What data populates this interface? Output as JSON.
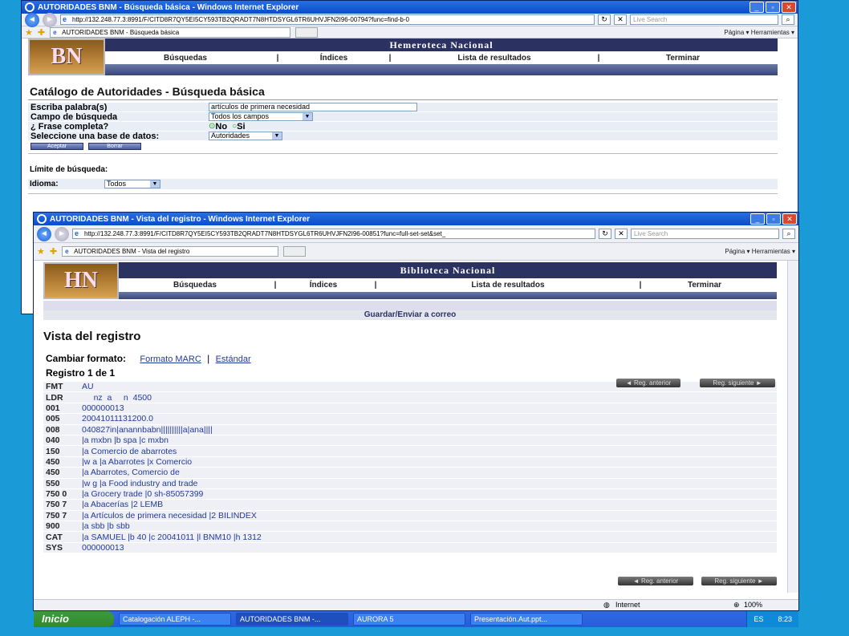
{
  "back_window": {
    "title": "AUTORIDADES BNM - Búsqueda básica - Windows Internet Explorer",
    "url": "http://132.248.77.3:8991/F/CITD8R7QY5EI5CY593TB2QRADT7N8HTDSYGL6TR6UHVJFN2I96-00794?func=find-b-0",
    "search_placeholder": "Live Search",
    "tab": "AUTORIDADES BNM - Búsqueda básica",
    "tools": "Página ▾  Herramientas ▾",
    "logo": "BN",
    "banner": "Hemeroteca Nacional",
    "menu": [
      "Búsquedas",
      "Índices",
      "Lista de resultados",
      "Terminar"
    ],
    "heading": "Catálogo de Autoridades - Búsqueda básica",
    "form": {
      "word_label": "Escriba palabra(s)",
      "word_value": "artículos de primera necesidad",
      "field_label": "Campo de búsqueda",
      "field_value": "Todos los campos",
      "phrase_label": "¿ Frase completa?",
      "phrase_no": "No",
      "phrase_yes": "Si",
      "db_label": "Seleccione una base de datos:",
      "db_value": "Autoridades",
      "accept": "Aceptar",
      "clear": "Borrar"
    },
    "limit_label": "Límite de búsqueda:",
    "lang_label": "Idioma:",
    "lang_value": "Todos"
  },
  "front_window": {
    "title": "AUTORIDADES BNM - Vista del registro - Windows Internet Explorer",
    "url": "http://132.248.77.3:8991/F/CITD8R7QY5EI5CY593TB2QRADT7N8HTDSYGL6TR6UHVJFN2I96-00851?func=full-set-set&set_",
    "search_placeholder": "Live Search",
    "tab": "AUTORIDADES BNM - Vista del registro",
    "tools": "Página ▾  Herramientas ▾",
    "logo": "HN",
    "banner": "Biblioteca Nacional",
    "menu": [
      "Búsquedas",
      "Índices",
      "Lista de resultados",
      "Terminar"
    ],
    "save_link": "Guardar/Enviar a correo",
    "heading": "Vista del registro",
    "format_label": "Cambiar formato:",
    "format_marc": "Formato MARC",
    "format_std": "Estándar",
    "record_count": "Registro 1 de 1",
    "prev": "◄ Reg. anterior",
    "next": "Reg. siguiente ►",
    "records": [
      [
        "FMT",
        "AU"
      ],
      [
        "LDR",
        "     nz  a     n  4500"
      ],
      [
        "001",
        "000000013"
      ],
      [
        "005",
        "20041011131200.0"
      ],
      [
        "008",
        "040827in|anannbabn||||||||||a|ana||||"
      ],
      [
        "040",
        "|a mxbn |b spa |c mxbn"
      ],
      [
        "150",
        "|a Comercio de abarrotes"
      ],
      [
        "450",
        "|w a |a Abarrotes |x Comercio"
      ],
      [
        "450",
        "|a Abarrotes, Comercio de"
      ],
      [
        "550",
        "|w g |a Food industry and trade"
      ],
      [
        "750 0",
        "|a Grocery trade |0 sh-85057399"
      ],
      [
        "750 7",
        "|a Abacerías |2 LEMB"
      ],
      [
        "750 7",
        "|a Artículos de primera necesidad |2 BILINDEX"
      ],
      [
        "900",
        "|a sbb |b sbb"
      ],
      [
        "CAT",
        "|a SAMUEL |b 40 |c 20041011 |l BNM10 |h 1312"
      ],
      [
        "SYS",
        "000000013"
      ]
    ],
    "status_internet": "Internet",
    "status_zoom": "100%"
  },
  "taskbar": {
    "start": "Inicio",
    "tasks": [
      "Catalogación ALEPH -...",
      "AUTORIDADES BNM -...",
      "AURORA 5",
      "Presentación.Aut.ppt..."
    ],
    "lang": "ES",
    "time": "8:23"
  }
}
